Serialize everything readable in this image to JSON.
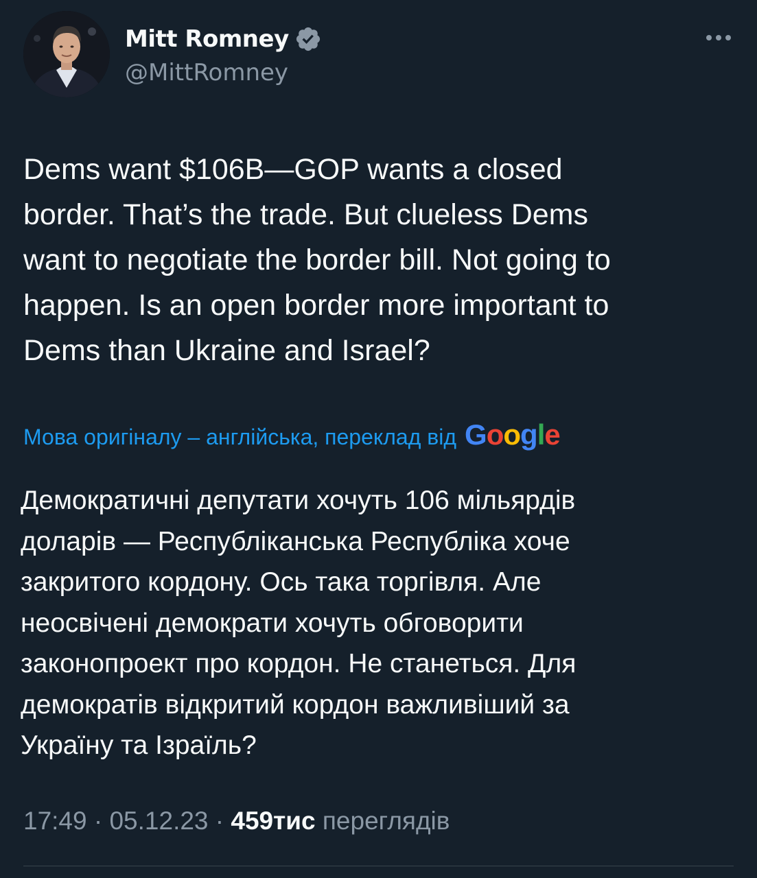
{
  "author": {
    "display_name": "Mitt Romney",
    "handle": "@MittRomney",
    "verified": true,
    "verified_icon": "verified-badge-icon",
    "avatar_icon": "profile-photo"
  },
  "more_icon": "more-horizontal-icon",
  "tweet": {
    "text": "Dems want $106B—GOP wants a closed\nborder. That’s the trade. But clueless Dems\nwant to negotiate the border bill. Not going to\nhappen. Is an open border more important to\nDems than Ukraine and Israel?"
  },
  "translation": {
    "note": "Мова оригіналу – англійська, переклад від",
    "provider": "Google",
    "provider_letters": [
      {
        "ch": "G",
        "color": "#4285f4"
      },
      {
        "ch": "o",
        "color": "#ea4335"
      },
      {
        "ch": "o",
        "color": "#fbbc05"
      },
      {
        "ch": "g",
        "color": "#4285f4"
      },
      {
        "ch": "l",
        "color": "#34a853"
      },
      {
        "ch": "e",
        "color": "#ea4335"
      }
    ],
    "text": "Демократичні депутати хочуть 106 мільярдів\nдоларів — Республіканська Республіка хоче\nзакритого кордону. Ось така торгівля. Але\nнеосвічені демократи хочуть обговорити\nзаконопроект про кордон. Не станеться. Для\nдемократів відкритий кордон важливіший за\nУкраїну та Ізраїль?"
  },
  "meta": {
    "time": "17:49",
    "separator": " · ",
    "date": "05.12.23",
    "views_count": "459тис",
    "views_label": "переглядів"
  },
  "colors": {
    "background": "#15202b",
    "text": "#f7f9f9",
    "secondary": "#8b98a5",
    "link": "#1d9bf0"
  }
}
